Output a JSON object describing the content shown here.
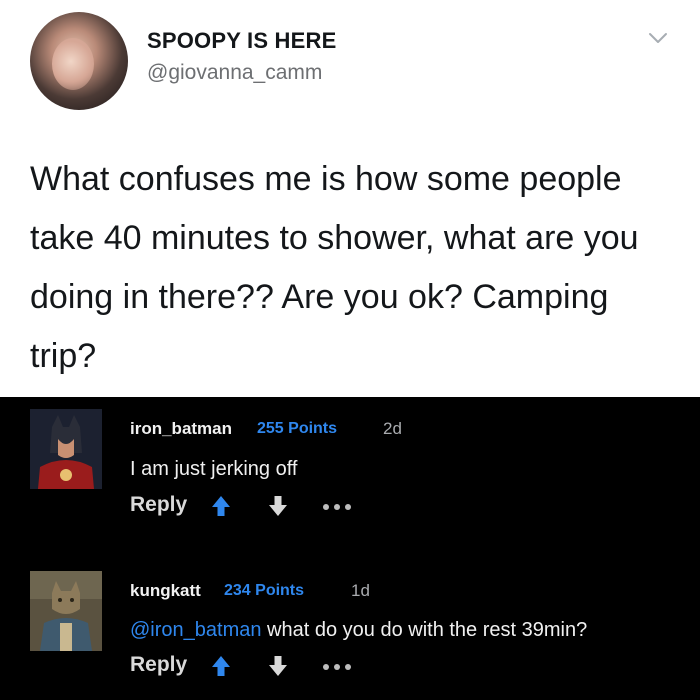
{
  "tweet": {
    "display_name": "SPOOPY IS HERE",
    "handle": "@giovanna_camm",
    "text": "What confuses me is how some people take 40 minutes to shower, what are you doing in there?? Are you ok? Camping trip?"
  },
  "comments": [
    {
      "username": "iron_batman",
      "points": "255 Points",
      "age": "2d",
      "text": "I am just jerking off",
      "mention": "",
      "reply_label": "Reply"
    },
    {
      "username": "kungkatt",
      "points": "234 Points",
      "age": "1d",
      "mention": "@iron_batman",
      "text": " what do you do with the rest 39min?",
      "reply_label": "Reply"
    }
  ],
  "colors": {
    "accent_blue": "#2f87ee",
    "tweet_bg": "#ffffff",
    "comments_bg": "#000000"
  },
  "icons": [
    "chevron-down-icon",
    "upvote-arrow-icon",
    "downvote-arrow-icon",
    "more-options-icon"
  ]
}
